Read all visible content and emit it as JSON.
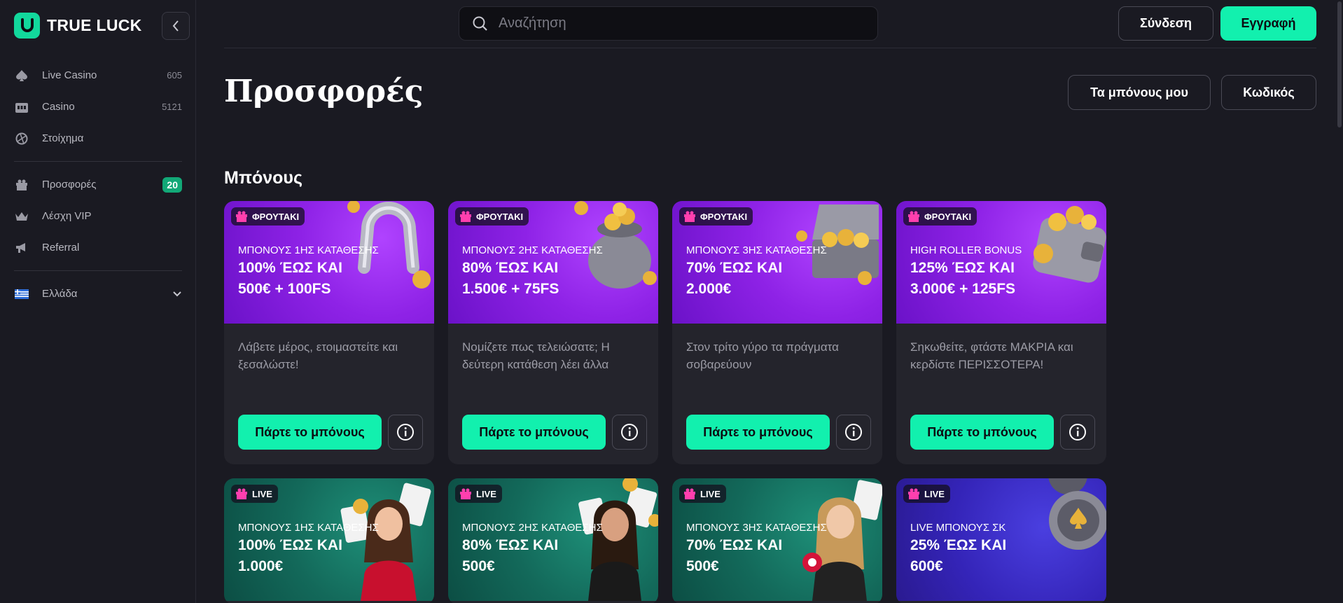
{
  "brand": {
    "name": "TRUE LUCK",
    "accent": "#12f0ae"
  },
  "sidebar": {
    "items": [
      {
        "label": "Live Casino",
        "count": "605",
        "icon": "spade-icon"
      },
      {
        "label": "Casino",
        "count": "5121",
        "icon": "slot-machine-icon"
      },
      {
        "label": "Στοίχημα",
        "count": "",
        "icon": "sports-ball-icon"
      }
    ],
    "items2": [
      {
        "label": "Προσφορές",
        "badge": "20",
        "icon": "gift-icon"
      },
      {
        "label": "Λέσχη VIP",
        "icon": "crown-icon"
      },
      {
        "label": "Referral",
        "icon": "megaphone-icon"
      }
    ],
    "language": {
      "label": "Ελλάδα",
      "icon": "greece-flag-icon"
    }
  },
  "header": {
    "search_placeholder": "Αναζήτηση",
    "login": "Σύνδεση",
    "register": "Εγγραφή"
  },
  "page": {
    "title": "Προσφορές",
    "my_bonuses": "Τα μπόνους μου",
    "code": "Κωδικός",
    "section_title": "Μπόνους"
  },
  "cards": [
    {
      "tag": "ΦΡΟΥΤΑΚΙ",
      "subtitle": "ΜΠΟΝΟΥΣ 1ΗΣ ΚΑΤΑΘΕΣΗΣ",
      "line1": "100% ΈΩΣ ΚΑΙ",
      "line2": "500€ + 100FS",
      "desc": "Λάβετε μέρος, ετοιμαστείτε και ξεσαλώστε!",
      "cta": "Πάρτε το μπόνους",
      "art": "horseshoe"
    },
    {
      "tag": "ΦΡΟΥΤΑΚΙ",
      "subtitle": "ΜΠΟΝΟΥΣ 2ΗΣ ΚΑΤΑΘΕΣΗΣ",
      "line1": "80% ΈΩΣ ΚΑΙ",
      "line2": "1.500€ + 75FS",
      "desc": "Νομίζετε πως τελειώσατε; Η δεύτερη κατάθεση λέει άλλα",
      "cta": "Πάρτε το μπόνους",
      "art": "coin-pot"
    },
    {
      "tag": "ΦΡΟΥΤΑΚΙ",
      "subtitle": "ΜΠΟΝΟΥΣ 3ΗΣ ΚΑΤΑΘΕΣΗΣ",
      "line1": "70% ΈΩΣ ΚΑΙ",
      "line2": "2.000€",
      "desc": "Στον τρίτο γύρο τα πράγματα σοβαρεύουν",
      "cta": "Πάρτε το μπόνους",
      "art": "treasure-chest"
    },
    {
      "tag": "ΦΡΟΥΤΑΚΙ",
      "subtitle": "HIGH ROLLER BONUS",
      "line1": "125% ΈΩΣ ΚΑΙ",
      "line2": "3.000€ + 125FS",
      "desc": "Σηκωθείτε, φτάστε ΜΑΚΡΙΑ και κερδίστε ΠΕΡΙΣΣΟΤΕΡΑ!",
      "cta": "Πάρτε το μπόνους",
      "art": "wallet"
    },
    {
      "tag": "LIVE",
      "subtitle": "ΜΠΟΝΟΥΣ 1ΗΣ ΚΑΤΑΘΕΣΗΣ",
      "line1": "100% ΈΩΣ ΚΑΙ",
      "line2": "1.000€",
      "art": "dealer"
    },
    {
      "tag": "LIVE",
      "subtitle": "ΜΠΟΝΟΥΣ 2ΗΣ ΚΑΤΑΘΕΣΗΣ",
      "line1": "80% ΈΩΣ ΚΑΙ",
      "line2": "500€",
      "art": "dealer"
    },
    {
      "tag": "LIVE",
      "subtitle": "ΜΠΟΝΟΥΣ 3ΗΣ ΚΑΤΑΘΕΣΗΣ",
      "line1": "70% ΈΩΣ ΚΑΙ",
      "line2": "500€",
      "art": "dealer"
    },
    {
      "tag": "LIVE",
      "subtitle": "LIVE ΜΠΟΝΟΥΣ ΣΚ",
      "line1": "25% ΈΩΣ ΚΑΙ",
      "line2": "600€",
      "art": "casino-chip"
    }
  ]
}
